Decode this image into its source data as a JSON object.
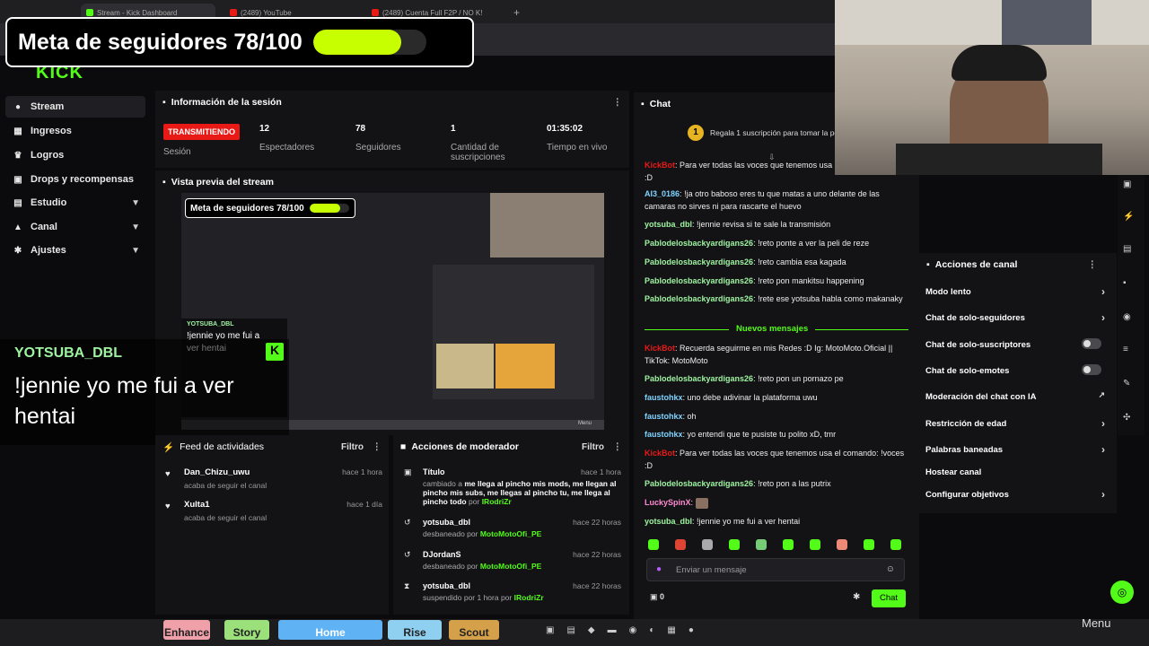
{
  "browser": {
    "tabs": [
      "Stream - Kick Dashboard",
      "(2489) YouTube",
      "(2489) Cuenta Full F2P / NO K!"
    ]
  },
  "goal": {
    "title": "Meta de seguidores 78/100",
    "progress": 0.78
  },
  "sidebar": {
    "items": [
      {
        "label": "Stream",
        "icon": "video-icon"
      },
      {
        "label": "Ingresos",
        "icon": "chart-icon"
      },
      {
        "label": "Logros",
        "icon": "trophy-icon"
      },
      {
        "label": "Drops y recompensas",
        "icon": "gift-icon"
      },
      {
        "label": "Estudio",
        "icon": "studio-icon"
      },
      {
        "label": "Canal",
        "icon": "user-icon"
      },
      {
        "label": "Ajustes",
        "icon": "gear-icon"
      }
    ]
  },
  "session": {
    "title": "Información de la sesión",
    "live_badge": "TRANSMITIENDO",
    "session_label": "Sesión",
    "stats": [
      {
        "value": "12",
        "label": "Espectadores"
      },
      {
        "value": "78",
        "label": "Seguidores"
      },
      {
        "value": "1",
        "label": "Cantidad de suscripciones"
      },
      {
        "value": "01:35:02",
        "label": "Tiempo en vivo"
      }
    ]
  },
  "preview": {
    "title": "Vista previa del stream",
    "goal": "Meta de seguidores 78/100",
    "menu": "Menu",
    "mini_caption": "!jennie yo me fui a ver hentai",
    "mini_user": "YOTSUBA_DBL"
  },
  "caption": {
    "user": "YOTSUBA_DBL",
    "text": "!jennie yo me fui a ver hentai"
  },
  "activity": {
    "title": "Feed de actividades",
    "filter": "Filtro",
    "items": [
      {
        "name": "Dan_Chizu_uwu",
        "desc": "acaba de seguir el canal",
        "time": "hace 1 hora"
      },
      {
        "name": "Xulta1",
        "desc": "acaba de seguir el canal",
        "time": "hace 1 día"
      }
    ]
  },
  "modactions": {
    "title": "Acciones de moderador",
    "filter": "Filtro",
    "items": [
      {
        "name": "Título",
        "time": "hace 1 hora",
        "pre": "cambiado a",
        "detail": "me llega al pincho mis mods, me llegan al pincho mis subs, me llegas al pincho tu, me llega al pincho todo",
        "by_pre": "por",
        "by": "IRodriZr"
      },
      {
        "name": "yotsuba_dbl",
        "time": "hace 22 horas",
        "action": "desbaneado por",
        "by": "MotoMotoOfi_PE"
      },
      {
        "name": "DJordanS",
        "time": "hace 22 horas",
        "action": "desbaneado por",
        "by": "MotoMotoOfi_PE"
      },
      {
        "name": "yotsuba_dbl",
        "time": "hace 22 horas",
        "action": "suspendido por 1 hora por",
        "by": "IRodriZr"
      }
    ]
  },
  "chat": {
    "title": "Chat",
    "gift_count": "1",
    "gift_text": "Regala 1 suscripción para tomar la po",
    "new_messages": "Nuevos mensajes",
    "input_placeholder": "Enviar un mensaje",
    "points": "0",
    "send": "Chat",
    "messages": [
      {
        "user": "KickBot",
        "text": "Para ver todas las voces que tenemos usa el comando: !voces :D"
      },
      {
        "user": "AI3_0186",
        "text": "!ja otro baboso eres tu que matas a uno delante de las camaras no sirves ni para rascarte el huevo"
      },
      {
        "user": "yotsuba_dbl",
        "text": "!jennie revisa si te sale la transmisión"
      },
      {
        "user": "Pablodelosbackyardigans26",
        "text": "!reto ponte a ver la peli de reze"
      },
      {
        "user": "Pablodelosbackyardigans26",
        "text": "!reto cambia esa kagada"
      },
      {
        "user": "Pablodelosbackyardigans26",
        "text": "!reto pon mankitsu happening"
      },
      {
        "user": "Pablodelosbackyardigans26",
        "text": "!rete ese yotsuba habla como makanaky"
      },
      {
        "user": "KickBot",
        "text": "Recuerda seguirme en mis Redes :D Ig: MotoMoto.Oficial || TikTok: MotoMoto"
      },
      {
        "user": "Pablodelosbackyardigans26",
        "text": "!reto pon un pornazo pe"
      },
      {
        "user": "faustohkx",
        "text": "uno debe adivinar la plataforma uwu"
      },
      {
        "user": "faustohkx",
        "text": "oh"
      },
      {
        "user": "faustohkx",
        "text": "yo entendi que te pusiste tu polito xD, tmr"
      },
      {
        "user": "KickBot",
        "text": "Para ver todas las voces que tenemos usa el comando: !voces :D"
      },
      {
        "user": "Pablodelosbackyardigans26",
        "text": "!reto pon a las putrix"
      },
      {
        "user": "LuckySpinX",
        "text": ""
      },
      {
        "user": "yotsuba_dbl",
        "text": "!jennie yo me fui a ver hentai"
      }
    ]
  },
  "channel_actions": {
    "title": "Acciones de canal",
    "items": [
      {
        "label": "Modo lento",
        "control": "chevron"
      },
      {
        "label": "Chat de solo-seguidores",
        "control": "chevron"
      },
      {
        "label": "Chat de solo-suscriptores",
        "control": "toggle"
      },
      {
        "label": "Chat de solo-emotes",
        "control": "toggle"
      },
      {
        "label": "Moderación del chat con IA",
        "control": "external"
      },
      {
        "label": "Restricción de edad",
        "control": "chevron"
      },
      {
        "label": "Palabras baneadas",
        "control": "chevron"
      },
      {
        "label": "Hostear canal",
        "control": "none"
      },
      {
        "label": "Configurar objetivos",
        "control": "chevron"
      }
    ]
  },
  "taskbar": {
    "buttons": [
      "Enhance",
      "Story",
      "Home",
      "Rise",
      "Scout"
    ],
    "menu": "Menu"
  },
  "colors": {
    "kick_green": "#53fc18",
    "live_red": "#e91916",
    "goal_bar": "#c8ff00"
  }
}
